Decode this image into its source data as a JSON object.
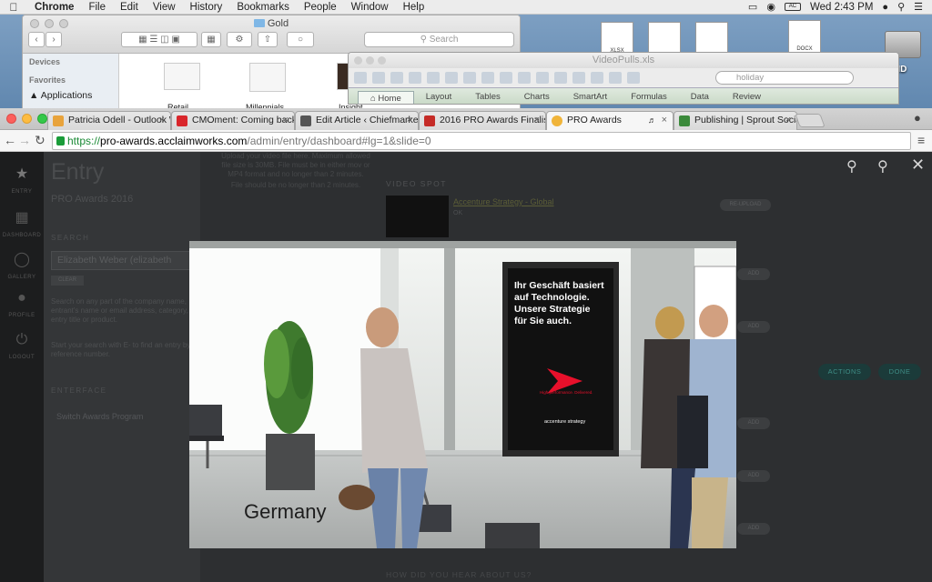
{
  "menubar": {
    "apple_icon": "apple-icon",
    "app_name": "Chrome",
    "items": [
      "File",
      "Edit",
      "View",
      "History",
      "Bookmarks",
      "People",
      "Window",
      "Help"
    ],
    "battery_label": "AC",
    "clock": "Wed 2:43 PM"
  },
  "desktop": {
    "files": [
      "XLSX",
      "DOCX"
    ],
    "drive_label": "tosh HD"
  },
  "finder": {
    "title": "Gold",
    "search_placeholder": "Search",
    "sidebar": {
      "devices_heading": "Devices",
      "favorites_heading": "Favorites",
      "applications_label": "Applications"
    },
    "thumb_labels": [
      "Retail",
      "Millennials",
      "Insight"
    ]
  },
  "excel": {
    "title": "VideoPulls.xls",
    "search_value": "holiday",
    "ribbon_tabs": [
      "Home",
      "Layout",
      "Tables",
      "Charts",
      "SmartArt",
      "Formulas",
      "Data",
      "Review"
    ]
  },
  "chrome": {
    "tabs": [
      {
        "title": "Patricia Odell - Outlook Web",
        "color": "#e8a33c"
      },
      {
        "title": "CMOment: Coming back | M",
        "color": "#d9262b"
      },
      {
        "title": "Edit Article ‹ Chiefmarketer",
        "color": "#555555"
      },
      {
        "title": "2016 PRO Awards Finalists",
        "color": "#c52b27"
      },
      {
        "title": "PRO Awards",
        "color": "#f0b43a"
      },
      {
        "title": "Publishing | Sprout Social",
        "color": "#3b8a3b"
      }
    ],
    "url": {
      "scheme": "https://",
      "host": "pro-awards.acclaimworks.com",
      "path": "/admin/entry/dashboard#lg=1&slide=0"
    }
  },
  "page": {
    "rail": [
      "ENTRY",
      "DASHBOARD",
      "GALLERY",
      "PROFILE",
      "LOGOUT"
    ],
    "heading": "Entry",
    "subheading": "PRO Awards 2016",
    "search_label": "SEARCH",
    "search_value": "Elizabeth Weber (elizabeth",
    "clear_label": "CLEAR",
    "help1": "Search on any part of the company name, entrant's name or email address, category, entry title or product.",
    "help2": "Start your search with E- to find an entry by reference number.",
    "interface_label": "ENTERFACE",
    "interface_item": "Switch Awards Program",
    "upload_text": "Upload your video file here. Maximum allowed file size is 30MB. File must be in either mov or MP4 format and no longer than 2 minutes.",
    "upload_text2": "File should be no longer than 2 minutes.",
    "video_spot_heading": "VIDEO SPOT",
    "video_spot_link": "Accenture Strategy - Global",
    "video_spot_status": "OK",
    "remove_label": "RE-UPLOAD",
    "add_label": "ADD",
    "actions_label": "ACTIONS",
    "done_label": "DONE",
    "bottom_question": "HOW DID YOU HEAR ABOUT US?"
  },
  "video": {
    "poster_lines": [
      "Ihr Geschäft basiert",
      "auf Technologie.",
      "Unsere Strategie",
      "für Sie auch."
    ],
    "poster_tagline": "High performance. Delivered.",
    "poster_brand": "accenture strategy",
    "caption": "Germany"
  }
}
